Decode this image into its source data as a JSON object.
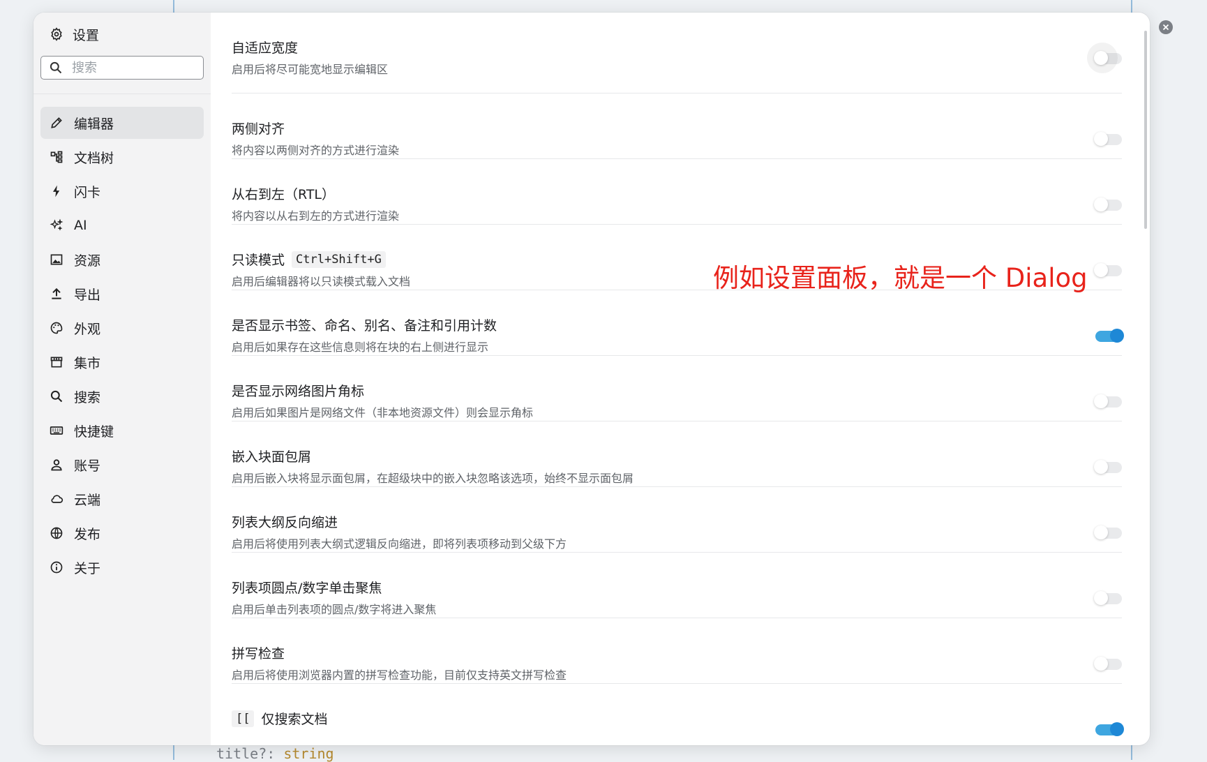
{
  "background": {
    "code_text": "title?: ",
    "code_type": "string"
  },
  "sidebar": {
    "title": "设置",
    "search_placeholder": "搜索",
    "items": [
      {
        "label": "编辑器",
        "icon": "pencil-icon",
        "active": true
      },
      {
        "label": "文档树",
        "icon": "tree-icon"
      },
      {
        "label": "闪卡",
        "icon": "lightning-icon"
      },
      {
        "label": "AI",
        "icon": "sparkle-icon"
      },
      {
        "label": "资源",
        "icon": "image-icon"
      },
      {
        "label": "导出",
        "icon": "upload-icon"
      },
      {
        "label": "外观",
        "icon": "palette-icon"
      },
      {
        "label": "集市",
        "icon": "store-icon"
      },
      {
        "label": "搜索",
        "icon": "search-icon"
      },
      {
        "label": "快捷键",
        "icon": "keyboard-icon"
      },
      {
        "label": "账号",
        "icon": "user-icon"
      },
      {
        "label": "云端",
        "icon": "cloud-icon"
      },
      {
        "label": "发布",
        "icon": "globe-icon"
      },
      {
        "label": "关于",
        "icon": "info-icon"
      }
    ]
  },
  "settings": [
    {
      "title": "自适应宽度",
      "desc": "启用后将尽可能宽地显示编辑区",
      "enabled": false
    },
    {
      "title": "两侧对齐",
      "desc": "将内容以两侧对齐的方式进行渲染",
      "enabled": false
    },
    {
      "title": "从右到左（RTL）",
      "desc": "将内容以从右到左的方式进行渲染",
      "enabled": false
    },
    {
      "title": "只读模式",
      "shortcut": "Ctrl+Shift+G",
      "desc": "启用后编辑器将以只读模式载入文档",
      "enabled": false
    },
    {
      "title": "是否显示书签、命名、别名、备注和引用计数",
      "desc": "启用后如果存在这些信息则将在块的右上侧进行显示",
      "enabled": true
    },
    {
      "title": "是否显示网络图片角标",
      "desc": "启用后如果图片是网络文件（非本地资源文件）则会显示角标",
      "enabled": false
    },
    {
      "title": "嵌入块面包屑",
      "desc": "启用后嵌入块将显示面包屑，在超级块中的嵌入块忽略该选项，始终不显示面包屑",
      "enabled": false
    },
    {
      "title": "列表大纲反向缩进",
      "desc": "启用后将使用列表大纲式逻辑反向缩进，即将列表项移动到父级下方",
      "enabled": false
    },
    {
      "title": "列表项圆点/数字单击聚焦",
      "desc": "启用后单击列表项的圆点/数字将进入聚焦",
      "enabled": false
    },
    {
      "title": "拼写检查",
      "desc": "启用后将使用浏览器内置的拼写检查功能，目前仅支持英文拼写检查",
      "enabled": false
    },
    {
      "title": "仅搜索文档",
      "prefix": "[[",
      "enabled": true
    }
  ],
  "annotation": "例如设置面板，就是一个 Dialog",
  "colors": {
    "toggle_on": "#3ea6e0",
    "annotation": "#e8231b"
  }
}
